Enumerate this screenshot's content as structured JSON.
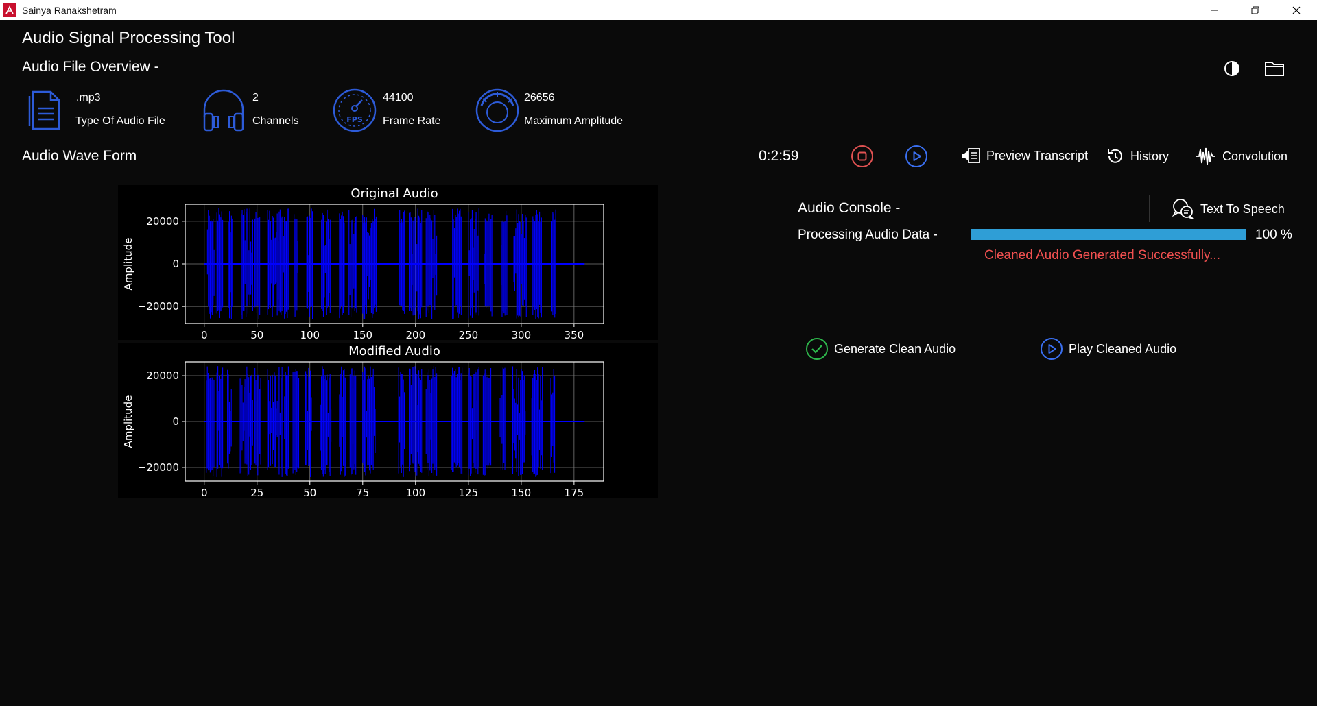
{
  "window": {
    "title": "Sainya Ranakshetram"
  },
  "app": {
    "title": "Audio Signal Processing Tool"
  },
  "overview": {
    "heading": "Audio File Overview -",
    "items": [
      {
        "value": ".mp3",
        "label": "Type Of Audio File",
        "icon": "document-icon"
      },
      {
        "value": "2",
        "label": "Channels",
        "icon": "headphones-icon"
      },
      {
        "value": "44100",
        "label": "Frame Rate",
        "icon": "fps-gauge-icon"
      },
      {
        "value": "26656",
        "label": "Maximum Amplitude",
        "icon": "amplitude-dial-icon"
      }
    ]
  },
  "waveform": {
    "heading": "Audio Wave Form"
  },
  "player": {
    "time": "0:2:59",
    "stop_color": "#e05252",
    "play_color": "#3a6ff0"
  },
  "toolbar": {
    "preview_transcript": "Preview Transcript",
    "history": "History",
    "convolution": "Convolution",
    "text_to_speech": "Text To Speech"
  },
  "console": {
    "heading": "Audio Console -",
    "processing_label": "Processing Audio Data -",
    "progress": 1.0,
    "progress_text": "100 %",
    "status": "Cleaned Audio Generated Successfully...",
    "status_color": "#f05050",
    "progress_color": "#2f9ed6"
  },
  "actions": {
    "generate_clean": "Generate Clean Audio",
    "play_cleaned": "Play Cleaned Audio"
  },
  "chart_data": [
    {
      "type": "line",
      "title": "Original Audio",
      "ylabel": "Amplitude",
      "xlabel": "",
      "xlim": [
        -18,
        378
      ],
      "ylim": [
        -28000,
        28000
      ],
      "xticks": [
        0,
        50,
        100,
        150,
        200,
        250,
        300,
        350
      ],
      "yticks": [
        20000,
        0,
        -20000
      ],
      "ytick_labels": [
        "20000",
        "0",
        "−20000"
      ],
      "grid": true,
      "series_color": "#0000ff",
      "x_end": 360,
      "bursts": [
        [
          3,
          11
        ],
        [
          12,
          18
        ],
        [
          23,
          27
        ],
        [
          35,
          46
        ],
        [
          48,
          53
        ],
        [
          60,
          74
        ],
        [
          75,
          80
        ],
        [
          85,
          89
        ],
        [
          97,
          103
        ],
        [
          111,
          120
        ],
        [
          128,
          133
        ],
        [
          137,
          145
        ],
        [
          150,
          163
        ],
        [
          185,
          190
        ],
        [
          194,
          206
        ],
        [
          210,
          220
        ],
        [
          235,
          244
        ],
        [
          250,
          260
        ],
        [
          265,
          273
        ],
        [
          281,
          287
        ],
        [
          293,
          305
        ],
        [
          311,
          320
        ],
        [
          329,
          333
        ]
      ]
    },
    {
      "type": "line",
      "title": "Modified Audio",
      "ylabel": "Amplitude",
      "xlabel": "",
      "xlim": [
        -9,
        189
      ],
      "ylim": [
        -26000,
        26000
      ],
      "xticks": [
        0,
        25,
        50,
        75,
        100,
        125,
        150,
        175
      ],
      "yticks": [
        20000,
        0,
        -20000
      ],
      "ytick_labels": [
        "20000",
        "0",
        "−20000"
      ],
      "grid": true,
      "series_color": "#0000ff",
      "x_end": 180,
      "bursts": [
        [
          1,
          5
        ],
        [
          6,
          9
        ],
        [
          11,
          13
        ],
        [
          17,
          23
        ],
        [
          24,
          27
        ],
        [
          30,
          37
        ],
        [
          38,
          40
        ],
        [
          42,
          45
        ],
        [
          48,
          51
        ],
        [
          55,
          60
        ],
        [
          64,
          67
        ],
        [
          69,
          72
        ],
        [
          75,
          81
        ],
        [
          92,
          95
        ],
        [
          97,
          103
        ],
        [
          105,
          110
        ],
        [
          117,
          122
        ],
        [
          125,
          130
        ],
        [
          132,
          136
        ],
        [
          140,
          143
        ],
        [
          146,
          152
        ],
        [
          155,
          160
        ],
        [
          164,
          166
        ]
      ]
    }
  ]
}
